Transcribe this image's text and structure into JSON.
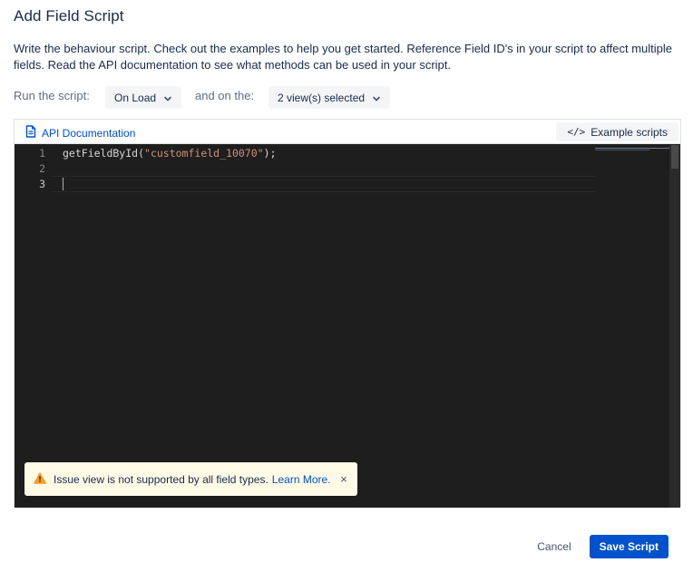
{
  "dialog": {
    "title": "Add Field Script",
    "description": "Write the behaviour script. Check out the examples to help you get started. Reference Field ID's in your script to affect multiple fields. Read the API documentation to see what methods can be used in your script."
  },
  "run_row": {
    "run_label": "Run the script:",
    "trigger_value": "On Load",
    "and_label": "and on the:",
    "views_value": "2 view(s) selected"
  },
  "editor": {
    "api_doc_label": "API Documentation",
    "example_label": "Example scripts",
    "example_icon": "</>",
    "lines": [
      {
        "num": "1",
        "prefix": "getFieldById(",
        "string": "\"customfield_10070\"",
        "suffix": ");"
      },
      {
        "num": "2",
        "prefix": "",
        "string": "",
        "suffix": ""
      },
      {
        "num": "3",
        "prefix": "",
        "string": "",
        "suffix": ""
      }
    ]
  },
  "toast": {
    "message": "Issue view is not supported by all field types.",
    "link": "Learn More.",
    "close": "×"
  },
  "footer": {
    "cancel_label": "Cancel",
    "save_label": "Save Script"
  },
  "colors": {
    "primary": "#0052cc",
    "editor_bg": "#1e1e1e",
    "toast_bg": "#fffae6",
    "warning": "#ff991f"
  }
}
